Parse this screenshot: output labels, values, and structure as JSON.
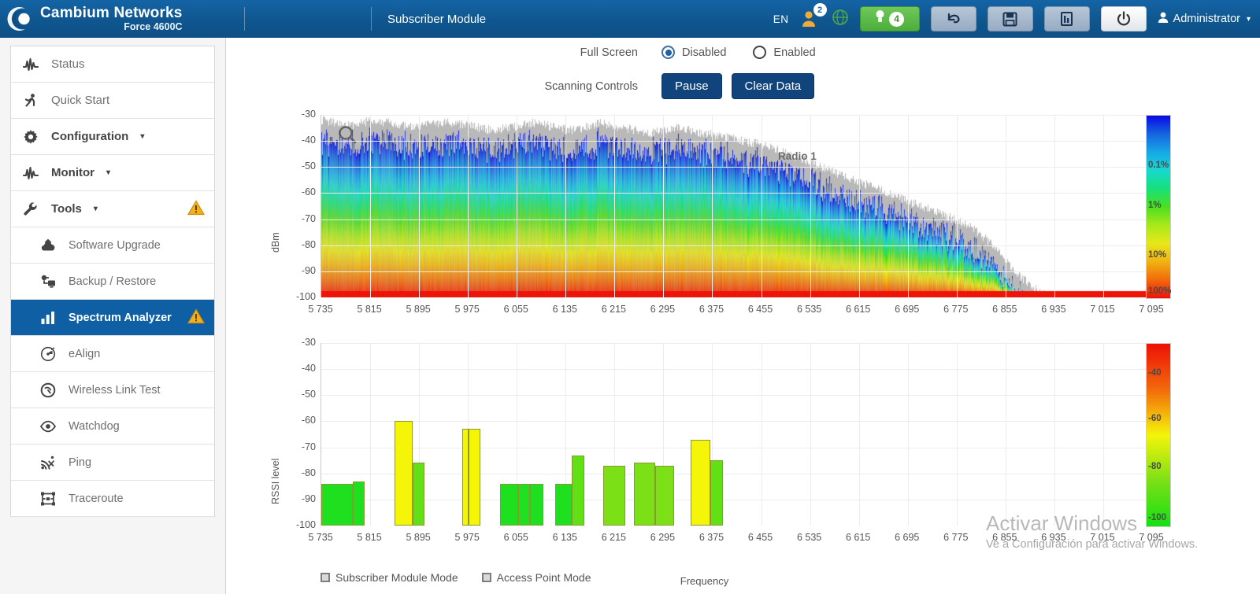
{
  "topbar": {
    "brand_name": "Cambium Networks",
    "brand_model": "Force 4600C",
    "page_title": "Subscriber Module",
    "language": "EN",
    "user_badge_count": "2",
    "alarm_count": "4",
    "admin_label": "Administrator",
    "icons": {
      "globe": "globe-icon",
      "undo": "undo-icon",
      "save": "save-disk-icon",
      "export": "export-icon",
      "power": "power-icon",
      "user": "user-icon",
      "bulb": "lightbulb-icon"
    }
  },
  "sidebar": {
    "items": [
      {
        "label": "Status",
        "icon": "waveform-icon",
        "level": 0,
        "active": false,
        "caret": false,
        "warn": false
      },
      {
        "label": "Quick Start",
        "icon": "runner-icon",
        "level": 0,
        "active": false,
        "caret": false,
        "warn": false
      },
      {
        "label": "Configuration",
        "icon": "gear-icon",
        "level": 0,
        "active": false,
        "caret": true,
        "warn": false
      },
      {
        "label": "Monitor",
        "icon": "waveform-icon",
        "level": 0,
        "active": false,
        "caret": true,
        "warn": false
      },
      {
        "label": "Tools",
        "icon": "wrench-icon",
        "level": 0,
        "active": false,
        "caret": true,
        "warn": true
      },
      {
        "label": "Software Upgrade",
        "icon": "upload-cloud-icon",
        "level": 1,
        "active": false,
        "caret": false,
        "warn": false
      },
      {
        "label": "Backup / Restore",
        "icon": "backup-restore-icon",
        "level": 1,
        "active": false,
        "caret": false,
        "warn": false
      },
      {
        "label": "Spectrum Analyzer",
        "icon": "bar-chart-icon",
        "level": 1,
        "active": true,
        "caret": false,
        "warn": true
      },
      {
        "label": "eAlign",
        "icon": "align-antenna-icon",
        "level": 1,
        "active": false,
        "caret": false,
        "warn": false
      },
      {
        "label": "Wireless Link Test",
        "icon": "gauge-icon",
        "level": 1,
        "active": false,
        "caret": false,
        "warn": false
      },
      {
        "label": "Watchdog",
        "icon": "eye-icon",
        "level": 1,
        "active": false,
        "caret": false,
        "warn": false
      },
      {
        "label": "Ping",
        "icon": "ping-signal-icon",
        "level": 1,
        "active": false,
        "caret": false,
        "warn": false
      },
      {
        "label": "Traceroute",
        "icon": "traceroute-icon",
        "level": 1,
        "active": false,
        "caret": false,
        "warn": false
      }
    ]
  },
  "controls": {
    "full_screen_label": "Full Screen",
    "disabled_label": "Disabled",
    "enabled_label": "Enabled",
    "full_screen_value": "Disabled",
    "scanning_controls_label": "Scanning Controls",
    "pause_label": "Pause",
    "clear_data_label": "Clear Data"
  },
  "watermark": {
    "line1": "Activar Windows",
    "line2": "Ve a Configuración para activar Windows."
  },
  "chart_data": [
    {
      "type": "heatmap",
      "title": "",
      "annotation": "Radio 1",
      "xlabel": "",
      "ylabel": "dBm",
      "ylim": [
        -100,
        -30
      ],
      "yticks": [
        -30,
        -40,
        -50,
        -60,
        -70,
        -80,
        -90,
        -100
      ],
      "xticks": [
        5735,
        5815,
        5895,
        5975,
        6055,
        6135,
        6215,
        6295,
        6375,
        6455,
        6535,
        6615,
        6695,
        6775,
        6855,
        6935,
        7015,
        7095
      ],
      "xtick_labels": [
        "5 735",
        "5 815",
        "5 895",
        "5 975",
        "6 055",
        "6 135",
        "6 215",
        "6 295",
        "6 375",
        "6 455",
        "6 535",
        "6 615",
        "6 695",
        "6 775",
        "6 855",
        "6 935",
        "7 015",
        "7 095"
      ],
      "colorbar": {
        "labels": [
          "0.1%",
          "1%",
          "10%",
          "100%"
        ],
        "label_positions_pct": [
          28,
          50,
          77,
          97
        ],
        "stops": [
          "#0a0ae6",
          "#1565e0",
          "#18a8e8",
          "#19d9d0",
          "#16e07a",
          "#4ce020",
          "#a8e81a",
          "#e8e81a",
          "#f0b412",
          "#f26a0c",
          "#ef1408"
        ]
      },
      "series_note": "max-hold envelope (grey) over occupancy-density heatmap",
      "envelope_top_dbm": [
        -32,
        -33,
        -34,
        -33,
        -32,
        -33,
        -34,
        -35,
        -34,
        -33,
        -33,
        -34,
        -35,
        -36,
        -35,
        -34,
        -33,
        -34,
        -35,
        -36,
        -35,
        -33,
        -34,
        -35,
        -36,
        -37,
        -36,
        -35,
        -36,
        -37,
        -38,
        -39,
        -40,
        -41,
        -42,
        -44,
        -46,
        -48,
        -50,
        -52,
        -54,
        -56,
        -58,
        -60,
        -62,
        -64,
        -66,
        -68,
        -70,
        -72,
        -76,
        -80,
        -86,
        -92,
        -96,
        -99,
        -100,
        -100,
        -100,
        -100,
        -100,
        -100,
        -100,
        -100
      ]
    },
    {
      "type": "bar",
      "title": "",
      "xlabel": "Frequency",
      "ylabel": "RSSI level",
      "ylim": [
        -100,
        -30
      ],
      "yticks": [
        -30,
        -40,
        -50,
        -60,
        -70,
        -80,
        -90,
        -100
      ],
      "xticks": [
        5735,
        5815,
        5895,
        5975,
        6055,
        6135,
        6215,
        6295,
        6375,
        6455,
        6535,
        6615,
        6695,
        6775,
        6855,
        6935,
        7015,
        7095
      ],
      "xtick_labels": [
        "5 735",
        "5 815",
        "5 895",
        "5 975",
        "6 055",
        "6 135",
        "6 215",
        "6 295",
        "6 375",
        "6 455",
        "6 535",
        "6 615",
        "6 695",
        "6 775",
        "6 855",
        "6 935",
        "7 015",
        "7 095"
      ],
      "legend": [
        {
          "label": "Subscriber Module Mode"
        },
        {
          "label": "Access Point Mode"
        }
      ],
      "legend_position": "bottom-left",
      "bars": [
        {
          "freq_start": 5735,
          "freq_end": 5786,
          "value": -84,
          "color": "#1ee01e",
          "mode": "Subscriber Module Mode"
        },
        {
          "freq_start": 5786,
          "freq_end": 5806,
          "value": -83,
          "color": "#1ee01e",
          "mode": "Subscriber Module Mode"
        },
        {
          "freq_start": 5855,
          "freq_end": 5884,
          "value": -60,
          "color": "#f5f50a",
          "mode": "Access Point Mode"
        },
        {
          "freq_start": 5884,
          "freq_end": 5904,
          "value": -76,
          "color": "#62e016",
          "mode": "Subscriber Module Mode"
        },
        {
          "freq_start": 5966,
          "freq_end": 5976,
          "value": -63,
          "color": "#f5f50a",
          "mode": "Access Point Mode"
        },
        {
          "freq_start": 5976,
          "freq_end": 5996,
          "value": -63,
          "color": "#f5f50a",
          "mode": "Access Point Mode"
        },
        {
          "freq_start": 6027,
          "freq_end": 6057,
          "value": -84,
          "color": "#1ee01e",
          "mode": "Subscriber Module Mode"
        },
        {
          "freq_start": 6057,
          "freq_end": 6077,
          "value": -84,
          "color": "#1ee01e",
          "mode": "Subscriber Module Mode"
        },
        {
          "freq_start": 6077,
          "freq_end": 6098,
          "value": -84,
          "color": "#1ee01e",
          "mode": "Subscriber Module Mode"
        },
        {
          "freq_start": 6118,
          "freq_end": 6145,
          "value": -84,
          "color": "#1ee01e",
          "mode": "Subscriber Module Mode"
        },
        {
          "freq_start": 6145,
          "freq_end": 6166,
          "value": -73,
          "color": "#62e016",
          "mode": "Subscriber Module Mode"
        },
        {
          "freq_start": 6196,
          "freq_end": 6232,
          "value": -77,
          "color": "#7ce016",
          "mode": "Subscriber Module Mode"
        },
        {
          "freq_start": 6247,
          "freq_end": 6282,
          "value": -76,
          "color": "#7ce016",
          "mode": "Subscriber Module Mode"
        },
        {
          "freq_start": 6282,
          "freq_end": 6313,
          "value": -77,
          "color": "#7ce016",
          "mode": "Subscriber Module Mode"
        },
        {
          "freq_start": 6340,
          "freq_end": 6372,
          "value": -67,
          "color": "#f5f50a",
          "mode": "Access Point Mode"
        },
        {
          "freq_start": 6372,
          "freq_end": 6392,
          "value": -75,
          "color": "#62e016",
          "mode": "Subscriber Module Mode"
        }
      ],
      "colorbar": {
        "labels": [
          "-40",
          "-60",
          "-80",
          "-100"
        ],
        "label_positions_pct": [
          17,
          42,
          68,
          96
        ],
        "stops": [
          "#ee1208",
          "#f36a0b",
          "#f5f50a",
          "#7ce016",
          "#13e013"
        ]
      }
    }
  ]
}
